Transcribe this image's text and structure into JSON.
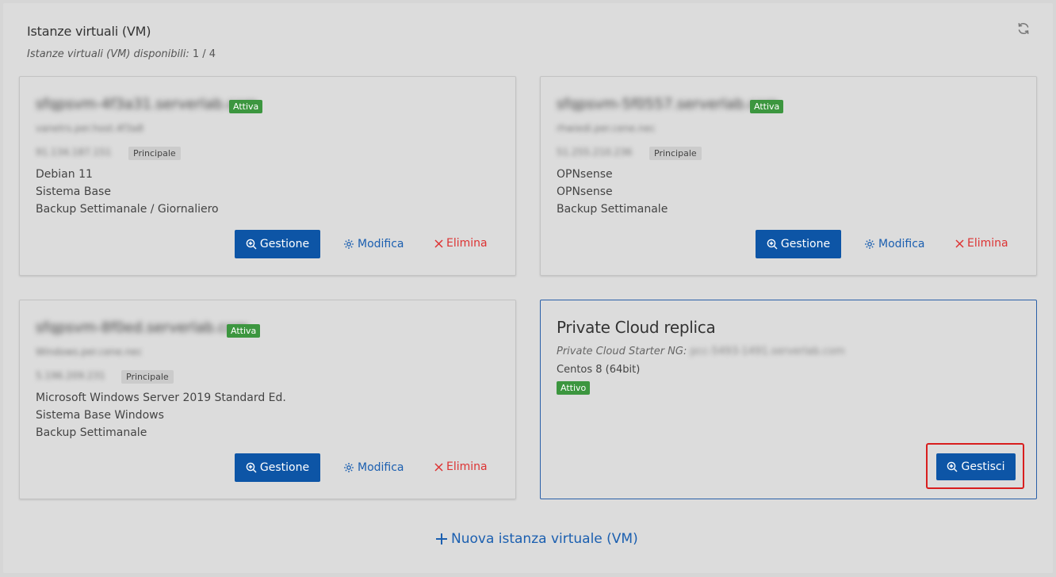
{
  "panel": {
    "title": "Istanze virtuali (VM)",
    "subtitle_label": "Istanze virtuali (VM) disponibili:",
    "subtitle_count": "1 / 4",
    "refresh_icon": "refresh-icon"
  },
  "cards": [
    {
      "hostname": "sfqpsvm-4f3a31.serverlab.com",
      "status": "Attiva",
      "line1": "vanetrs.per.host.4f3a8",
      "ip": "91.134.187.151",
      "ip_badge": "Principale",
      "details": [
        "Debian 11",
        "Sistema Base",
        "Backup Settimanale / Giornaliero"
      ],
      "manage_label": "Gestione",
      "edit_label": "Modifica",
      "delete_label": "Elimina"
    },
    {
      "hostname": "sfqpsvm-5f0557.serverlab.com",
      "status": "Attiva",
      "line1": "rhwiedi.per.cene.nec",
      "ip": "51.255.210.236",
      "ip_badge": "Principale",
      "details": [
        "OPNsense",
        "OPNsense",
        "Backup Settimanale"
      ],
      "manage_label": "Gestione",
      "edit_label": "Modifica",
      "delete_label": "Elimina"
    },
    {
      "hostname": "sfqpsvm-8f0ed.serverlab.com",
      "status": "Attiva",
      "line1": "Windows.per.cene.nec",
      "ip": "5.196.209.231",
      "ip_badge": "Principale",
      "details": [
        "Microsoft Windows Server 2019 Standard Ed.",
        "Sistema Base Windows",
        "Backup Settimanale"
      ],
      "manage_label": "Gestione",
      "edit_label": "Modifica",
      "delete_label": "Elimina"
    },
    {
      "title": "Private Cloud replica",
      "plan_label": "Private Cloud Starter NG:",
      "plan_host": "pcc-5493-1491.serverlab.com",
      "os": "Centos 8 (64bit)",
      "status": "Attivo",
      "manage_label": "Gestisci"
    }
  ],
  "footer": {
    "new_vm_label": "Nuova istanza virtuale (VM)"
  },
  "colors": {
    "primary": "#0d55a6",
    "success": "#3c963f",
    "danger": "#d33333",
    "link": "#1b5fb0",
    "highlight": "#d81e1e"
  }
}
